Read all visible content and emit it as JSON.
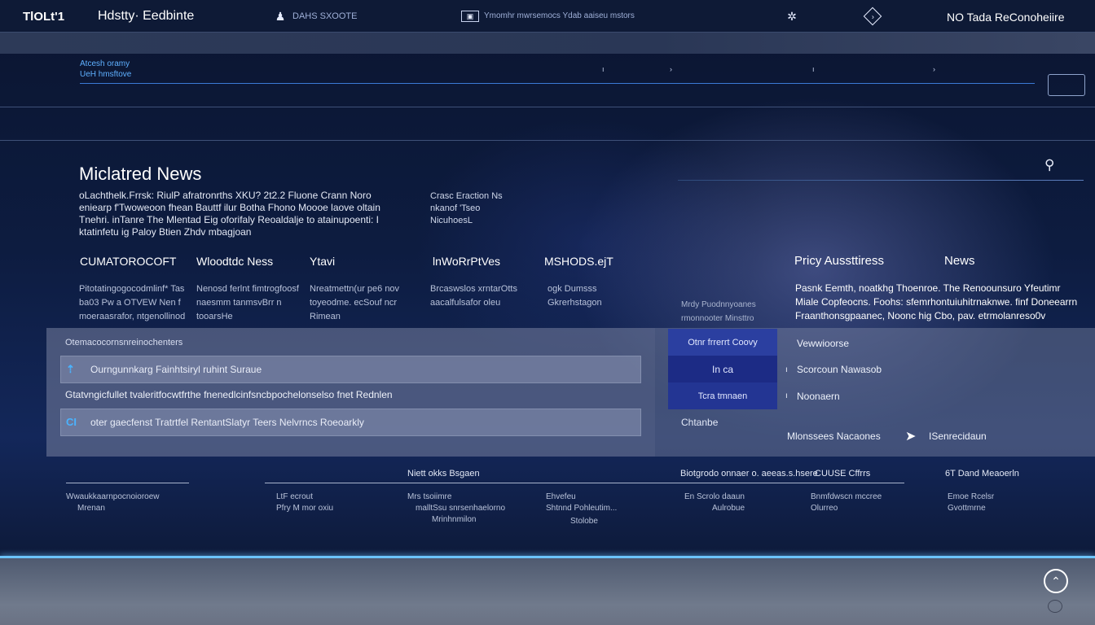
{
  "topbar": {
    "brand": "TlOLt'1",
    "site_title": "Hdstty· Eedbinte",
    "nav_links": [
      {
        "label": "DAHS SXOOTE"
      },
      {
        "label": "Ymomhr mwrsemocs Ydab aaiseu mstors"
      }
    ],
    "right_label": "NO  Tada ReConoheiire"
  },
  "breadcrumb": {
    "line1": "Atcesh oramy",
    "line2": "UeH hmsftove"
  },
  "main": {
    "title": "Miclatred News",
    "intro": "oLachthelk.Frrsk: RiulP afratronrths XKU? 2t2.2 Fluone Crann Noro eniearp f'Twoweoon fhean Bauttf ilur Botha Fhono Moooe laove oltain Tnehri. inTanre The Mlentad Eig oforifaly Reoaldalje to atainupoenti: I ktatinfetu ig Paloy Btien Zhdv mbagjoan",
    "side_note": "Crasc Eraction Ns nkanof 'Tseo NicuhoesL",
    "search_icon": "search-icon"
  },
  "columns": [
    {
      "head": "CUMATOROCOFT",
      "text": "Pitotatingogocodmlinf* Tas ba03 Pw a OTVEW Nen f moeraasrafor, ntgenollinod"
    },
    {
      "head": "Wloodtdc Ness",
      "text": "Nenosd ferlnt fimtrogfoosf naesmm tanmsvBrr n tooarsHe"
    },
    {
      "head": "Ytavi",
      "text": "Nreatmettn(ur pe6 nov toyeodme. ecSouf ncr Rimean"
    },
    {
      "head": "lnWoRrPtVes",
      "text": "Brcaswslos xrntarOtts aacalfulsafor oleu"
    },
    {
      "head": "MSHODS.ejT",
      "text": "ogk Dumsss Gkrerhstagon"
    }
  ],
  "right_section": {
    "head1": "Pricy Aussttiress",
    "head2": "News",
    "text": "Pasnk Eemth, noatkhg Thoenroe. The Renoounsuro Yfeutimr Miale Copfeocns. Foohs: sfemrhontuiuhitrnaknwe. finf Doneearrn Fraanthonsgpaanec, Noonc hig Cbo, pav. etrmolanreso0v",
    "small_text": "Mrdy Puodnnyoanes rmonnooter Minsttro"
  },
  "panel": {
    "header": "Otemacocornsnreinochenters",
    "row1": "Ourngunnkarg Fainhtsiryl  ruhint Suraue",
    "middle": "Gtatvngicfullet tvaleritfocwtfrthe fnenedlcinfsncbpochelonselso fnet Rednlen",
    "row2": "oter gaecfenst Tratrtfel RentantSlatyr Teers Nelvrncs Roeoarkly",
    "row1_icon": "bookmark-icon",
    "row2_icon": "info-icon"
  },
  "right_panel": {
    "buttons": [
      {
        "label": "Otnr frrerrt Coovy"
      },
      {
        "label": "In   ca"
      },
      {
        "label": "Tcra tmnaen"
      }
    ],
    "plain_label": "Chtanbe",
    "list": [
      {
        "label": "Vewwioorse"
      },
      {
        "label": "Scorcoun Nawasob"
      },
      {
        "label": "Noonaern"
      }
    ],
    "footer_left": "Mlonssees Nacaones",
    "footer_right": "ISenrecidaun"
  },
  "footer": {
    "col_heads": [
      "Niett okks Bsgaen",
      "Biotgrodo onnaer o. aeeas.s.hsere",
      "CUUSE Cffrrs",
      "6T Dand Meaoerln"
    ],
    "items": [
      {
        "a": "Wwaukkaarnpocnoioroew",
        "b": "Mrenan"
      },
      {
        "a": "LtF ecrout",
        "b": "Pfry M mor oxiu"
      },
      {
        "a": "Mrs tsoiimre",
        "b": "malltSsu snrsenhaelorno",
        "c": "Mrinhnmilon"
      },
      {
        "a": "Ehvefeu",
        "b": "Shtnnd Pohleutim..."
      },
      {
        "a": "En  Scrolo daaun",
        "b": "Aulrobue"
      },
      {
        "a": "Bnmfdwscn mccree",
        "b": "Olurreo"
      },
      {
        "a": "Emoe Rcelsr",
        "b": "Gvottmrne"
      }
    ],
    "tiny": [
      "Stolobe"
    ]
  },
  "bottom": {
    "back_top_icon": "arrow-up-icon",
    "back_top_glyph": "⌃"
  }
}
